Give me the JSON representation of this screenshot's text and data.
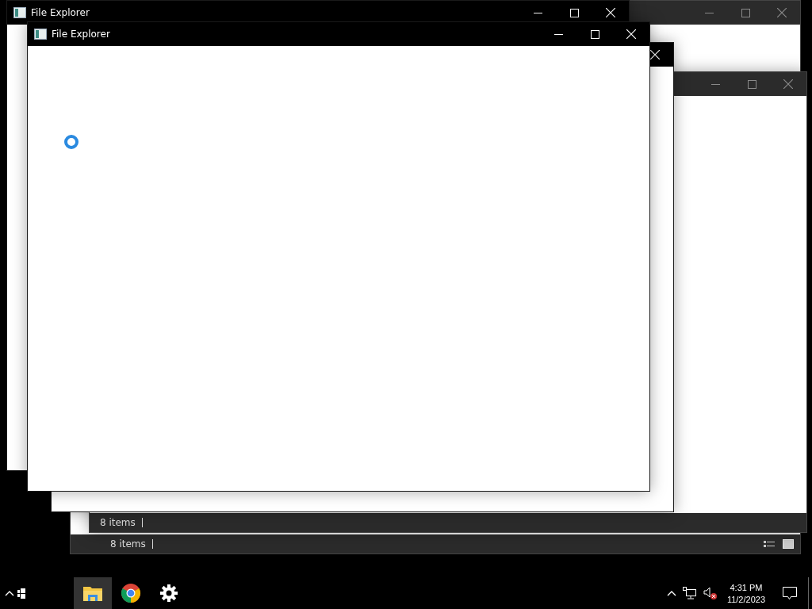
{
  "windows": [
    {
      "active": true,
      "title": "File Explorer",
      "controls": [
        {
          "kind": "minimize"
        },
        {
          "kind": "maximize"
        },
        {
          "kind": "close"
        }
      ]
    },
    {
      "active": true,
      "title": "File Explorer",
      "controls": [
        {
          "kind": "minimize"
        },
        {
          "kind": "maximize"
        },
        {
          "kind": "close"
        }
      ]
    },
    {
      "active": true,
      "controls": [
        {
          "kind": "close"
        }
      ]
    },
    {
      "active": false,
      "controls": [
        {
          "kind": "minimize"
        },
        {
          "kind": "maximize"
        },
        {
          "kind": "close"
        }
      ],
      "status": "8 items"
    },
    {
      "active": false,
      "controls": [
        {
          "kind": "minimize"
        },
        {
          "kind": "maximize"
        },
        {
          "kind": "close"
        }
      ],
      "status": "8 items"
    }
  ],
  "busy_cursor": true,
  "taskbar": {
    "apps": [
      {
        "kind": "explorer",
        "selected": true
      },
      {
        "kind": "chrome",
        "selected": false
      },
      {
        "kind": "settings",
        "selected": false
      }
    ],
    "tray": {
      "muted": true,
      "time": "4:31 PM",
      "date": "11/2/2023"
    }
  }
}
